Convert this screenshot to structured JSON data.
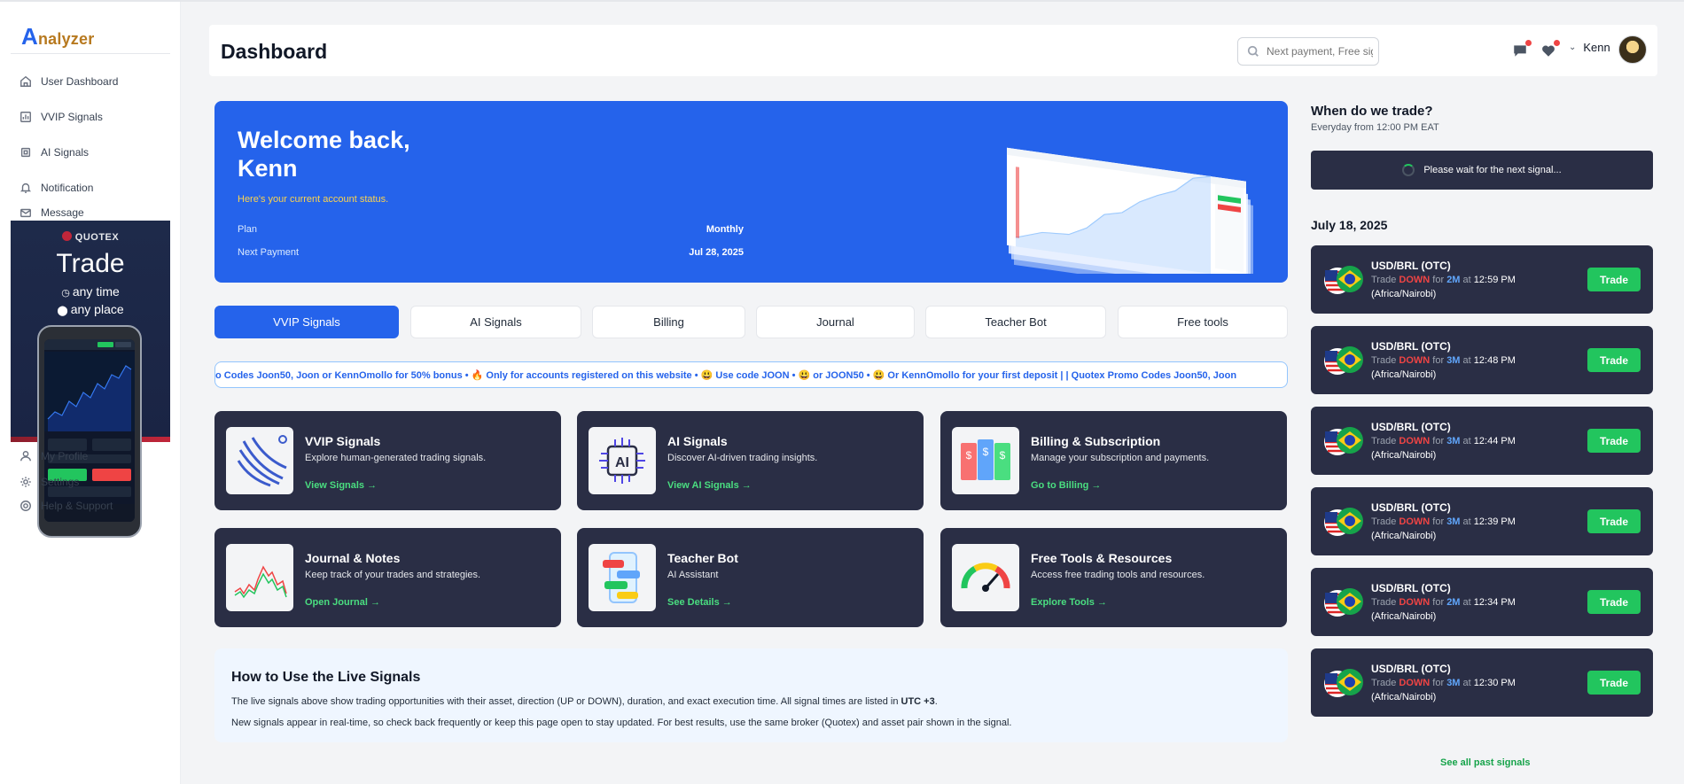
{
  "sidebar": {
    "logo_letter": "A",
    "logo_rest": "nalyzer",
    "items_top": [
      {
        "label": "User Dashboard"
      },
      {
        "label": "VVIP Signals"
      },
      {
        "label": "AI Signals"
      },
      {
        "label": "Notification"
      },
      {
        "label": "Message"
      }
    ],
    "ad": {
      "brand": "QUOTEX",
      "headline": "Trade",
      "line1": "any time",
      "line2": "any place"
    },
    "items_bottom": [
      {
        "label": "My Profile"
      },
      {
        "label": "Settings"
      },
      {
        "label": "Help & Support"
      }
    ]
  },
  "header": {
    "title": "Dashboard",
    "search_placeholder": "Next payment, Free signal",
    "user_name": "Kenn"
  },
  "welcome": {
    "line1": "Welcome back,",
    "line2": "Kenn",
    "status": "Here's your current account status.",
    "plan_label": "Plan",
    "plan_value": "Monthly",
    "next_label": "Next Payment",
    "next_value": "Jul 28, 2025"
  },
  "tabs": [
    {
      "label": "VVIP Signals",
      "active": true
    },
    {
      "label": "AI Signals"
    },
    {
      "label": "Billing"
    },
    {
      "label": "Journal"
    },
    {
      "label": "Teacher Bot"
    },
    {
      "label": "Free tools"
    }
  ],
  "ticker": {
    "text": "o Codes Joon50, Joon or KennOmollo for 50% bonus • 🔥 Only for accounts registered on this website • 😃 Use code JOON • 😃 or JOON50 • 😃 Or KennOmollo for your first deposit |          | Quotex Promo Codes Joon50, Joon"
  },
  "cards": [
    {
      "title": "VVIP Signals",
      "desc": "Explore human-generated trading signals.",
      "link": "View Signals →",
      "icon": "wave-lines-icon"
    },
    {
      "title": "AI Signals",
      "desc": "Discover AI-driven trading insights.",
      "link": "View AI Signals →",
      "icon": "ai-chip-icon"
    },
    {
      "title": "Billing & Subscription",
      "desc": "Manage your subscription and payments.",
      "link": "Go to Billing →",
      "icon": "billing-cards-icon"
    },
    {
      "title": "Journal & Notes",
      "desc": "Keep track of your trades and strategies.",
      "link": "Open Journal →",
      "icon": "line-chart-icon"
    },
    {
      "title": "Teacher Bot",
      "desc": "AI Assistant",
      "link": "See Details →",
      "icon": "chat-phone-icon"
    },
    {
      "title": "Free Tools & Resources",
      "desc": "Access free trading tools and resources.",
      "link": "Explore Tools →",
      "icon": "gauge-icon"
    }
  ],
  "howto": {
    "title": "How to Use the Live Signals",
    "p1_start": "The live signals above show trading opportunities with their asset, direction (UP or DOWN), duration, and exact execution time. All signal times are listed in ",
    "p1_bold": "UTC +3",
    "p1_end": ".",
    "p2": "New signals appear in real-time, so check back frequently or keep this page open to stay updated. For best results, use the same broker (Quotex) and asset pair shown in the signal."
  },
  "schedule": {
    "title": "When do we trade?",
    "subtitle": "Everyday from 12:00 PM EAT",
    "wait_text": "Please wait for the next signal..."
  },
  "signals_date": "July 18, 2025",
  "signals": [
    {
      "pair": "USD/BRL (OTC)",
      "direction": "DOWN",
      "duration": "2M",
      "time": "12:59 PM",
      "zone": "(Africa/Nairobi)"
    },
    {
      "pair": "USD/BRL (OTC)",
      "direction": "DOWN",
      "duration": "3M",
      "time": "12:48 PM",
      "zone": "(Africa/Nairobi)"
    },
    {
      "pair": "USD/BRL (OTC)",
      "direction": "DOWN",
      "duration": "3M",
      "time": "12:44 PM",
      "zone": "(Africa/Nairobi)"
    },
    {
      "pair": "USD/BRL (OTC)",
      "direction": "DOWN",
      "duration": "3M",
      "time": "12:39 PM",
      "zone": "(Africa/Nairobi)"
    },
    {
      "pair": "USD/BRL (OTC)",
      "direction": "DOWN",
      "duration": "2M",
      "time": "12:34 PM",
      "zone": "(Africa/Nairobi)"
    },
    {
      "pair": "USD/BRL (OTC)",
      "direction": "DOWN",
      "duration": "3M",
      "time": "12:30 PM",
      "zone": "(Africa/Nairobi)"
    }
  ],
  "signal_words": {
    "trade": "Trade",
    "for": "for",
    "at": "at",
    "button": "Trade"
  },
  "see_all": "See all past signals",
  "colors": {
    "accent": "#2563eb",
    "card_bg": "#2a2e45",
    "success": "#22c55e",
    "danger": "#ef4444"
  }
}
